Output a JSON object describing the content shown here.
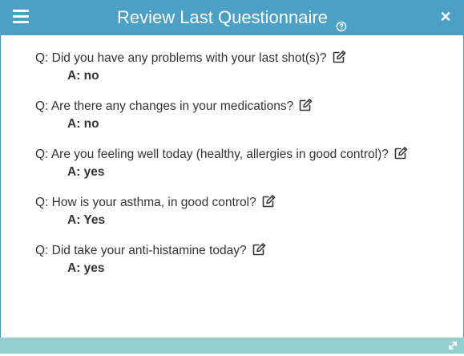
{
  "header": {
    "title": "Review Last Questionnaire",
    "menu_icon": "hamburger-menu-icon",
    "help_icon": "question-circle-icon",
    "close_label": "✕",
    "color": "#4c9fc5"
  },
  "questions": [
    {
      "question": "Q: Did you have any problems with your last shot(s)?",
      "answer": "A: no"
    },
    {
      "question": "Q: Are there any changes in your medications?",
      "answer": "A: no"
    },
    {
      "question": "Q: Are you feeling well today (healthy, allergies in good control)?",
      "answer": "A: yes"
    },
    {
      "question": "Q: How is your asthma, in good control?",
      "answer": "A: Yes"
    },
    {
      "question": "Q: Did take your anti-histamine today?",
      "answer": "A: yes"
    }
  ],
  "footer": {
    "resize_icon": "resize-diagonal-icon",
    "color": "#96cfcf"
  }
}
